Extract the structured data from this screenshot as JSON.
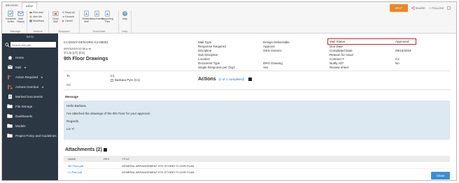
{
  "ribbon": {
    "tabs": [
      "BROWSE",
      "VIEW"
    ],
    "groups": [
      {
        "label": "Manage",
        "buttons": [
          "Complete Action",
          "Mail History"
        ],
        "small": []
      },
      {
        "label": "Actions",
        "buttons": [],
        "small": [
          "Print Mail",
          "Alert Me",
          "Workflows"
        ]
      },
      {
        "label": "Respond",
        "buttons": [
          "Close Mail"
        ],
        "small": [
          "Reply All",
          "Forward",
          "Cancel"
        ]
      },
      {
        "label": "Download",
        "buttons": [
          "Related Mail",
          "Attachments",
          "Supporting Files"
        ],
        "small": []
      },
      {
        "label": "Help",
        "buttons": [
          "Help"
        ],
        "small": []
      }
    ],
    "help_label": "HELP",
    "share_label": "SHARE",
    "follow_label": "FOLLOW"
  },
  "sidebar": {
    "project": "BETA",
    "search_placeholder": "Search this site",
    "items": [
      {
        "label": "Home",
        "star": false,
        "icon": "home-icon"
      },
      {
        "label": "Mail",
        "star": true,
        "icon": "mail-icon"
      },
      {
        "label": "Action Required",
        "star": true,
        "icon": "flag-icon"
      },
      {
        "label": "Actions Overdue",
        "star": true,
        "icon": "alert-flag-icon"
      },
      {
        "label": "Marked Documents",
        "star": false,
        "icon": "marked-documents-icon"
      },
      {
        "label": "File Storage",
        "star": false,
        "icon": "folder-icon"
      },
      {
        "label": "Dashboards",
        "star": false,
        "icon": "folder-icon"
      },
      {
        "label": "Models",
        "star": false,
        "icon": "folder-icon"
      },
      {
        "label": "Project Policy and Guidelines",
        "star": false,
        "icon": "folder-icon"
      }
    ]
  },
  "mail": {
    "number": "C1-DOSY-GEN-DRG-C2-00001",
    "datetime": "09/10/2019 02:35 p.m.",
    "sender": "Yi Lin (LT) (C1)",
    "subject": "9th Floor Drawings",
    "col1_labels": [
      "Mail Type",
      "Response Required",
      "Discipline",
      "Sub Discipline",
      "Location",
      "Document Type",
      "Single Response per Org?"
    ],
    "col1_values": [
      "",
      "",
      "",
      "",
      "",
      "",
      "Yes"
    ],
    "col2_labels": [
      "Design Deliverable",
      "Approve",
      "GEN Generic",
      "",
      "",
      "DRG Drawing",
      "Yes"
    ],
    "col3_labels": [
      "Mail Status",
      "Due Date",
      "Completed Date",
      "Reason for Issue",
      "Contract #",
      "Notify All?",
      "Review sheet"
    ],
    "col3_values": [
      "Approved",
      "",
      "09/10/2019",
      "",
      "C2",
      "No",
      ""
    ],
    "to_label": "To",
    "cc_label": "CC",
    "to_org": "C1",
    "to_person": "Barbara Pym (C1)",
    "actions_title": "Actions",
    "actions_status": "(1 of 1 completed)",
    "message_label": "Message",
    "message_lines": [
      "Hello Barbara,",
      "I've attached the drawings of the 9th Floor for your approval.",
      "Regards,",
      "Lin Yi"
    ],
    "attachments_title": "Attachments (2)",
    "attachment_headers": [
      "NAME",
      "REV",
      "TITLE"
    ],
    "attachments": [
      {
        "name": "9th Floor.pdf",
        "rev": "",
        "title": "GENERAL ARRANGEMENT 9TH STOREY FLOOR PLAN"
      },
      {
        "name": "LT-Plan.pdf",
        "rev": "",
        "title": "GENERAL ARRANGEMENT 9TH STOREY FLOOR PLAN"
      }
    ],
    "close_label": "Close"
  },
  "colors": {
    "accent": "#3a8fd6",
    "help": "#f0861f",
    "sidebar": "#2b3743",
    "status_highlight": "#c0272d",
    "message_bg": "#dce8f2"
  }
}
